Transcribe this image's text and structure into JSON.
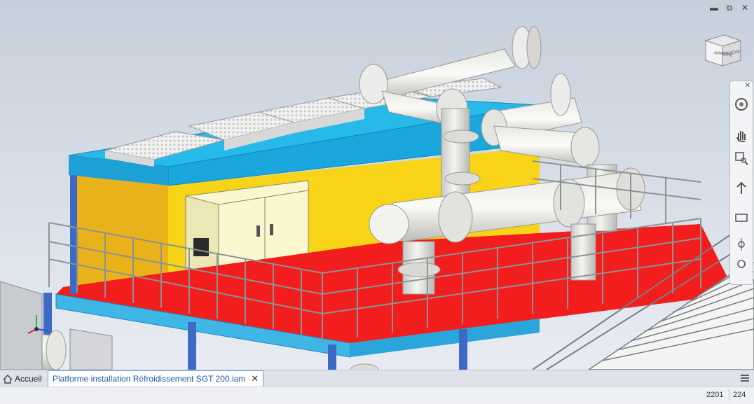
{
  "window": {
    "minimize_icon": "minimize-icon",
    "restore_icon": "restore-icon"
  },
  "viewcube": {
    "face_left": "ARRIÈRE",
    "face_right": "GAUCHE"
  },
  "navbar": {
    "tools": [
      "full-navigation-wheel-icon",
      "pan-icon",
      "zoom-icon",
      "orbit-icon",
      "look-at-icon",
      "free-orbit-icon",
      "constrained-orbit-icon"
    ]
  },
  "tabs": {
    "home_label": "Accueil",
    "document_label": "Platforme installation Réfroidissement SGT 200.iam",
    "close_symbol": "✕"
  },
  "status": {
    "count_1": "2201",
    "count_2": "224"
  },
  "colors": {
    "viewport_top": "#c7d0dc",
    "viewport_bottom": "#e9edf3",
    "frame_blue": "#20b8ea",
    "enclosure_yellow": "#f6d21c",
    "floor_red": "#f21b1b",
    "structure_blue": "#3c6bc0",
    "tab_accent": "#2a79c9"
  }
}
